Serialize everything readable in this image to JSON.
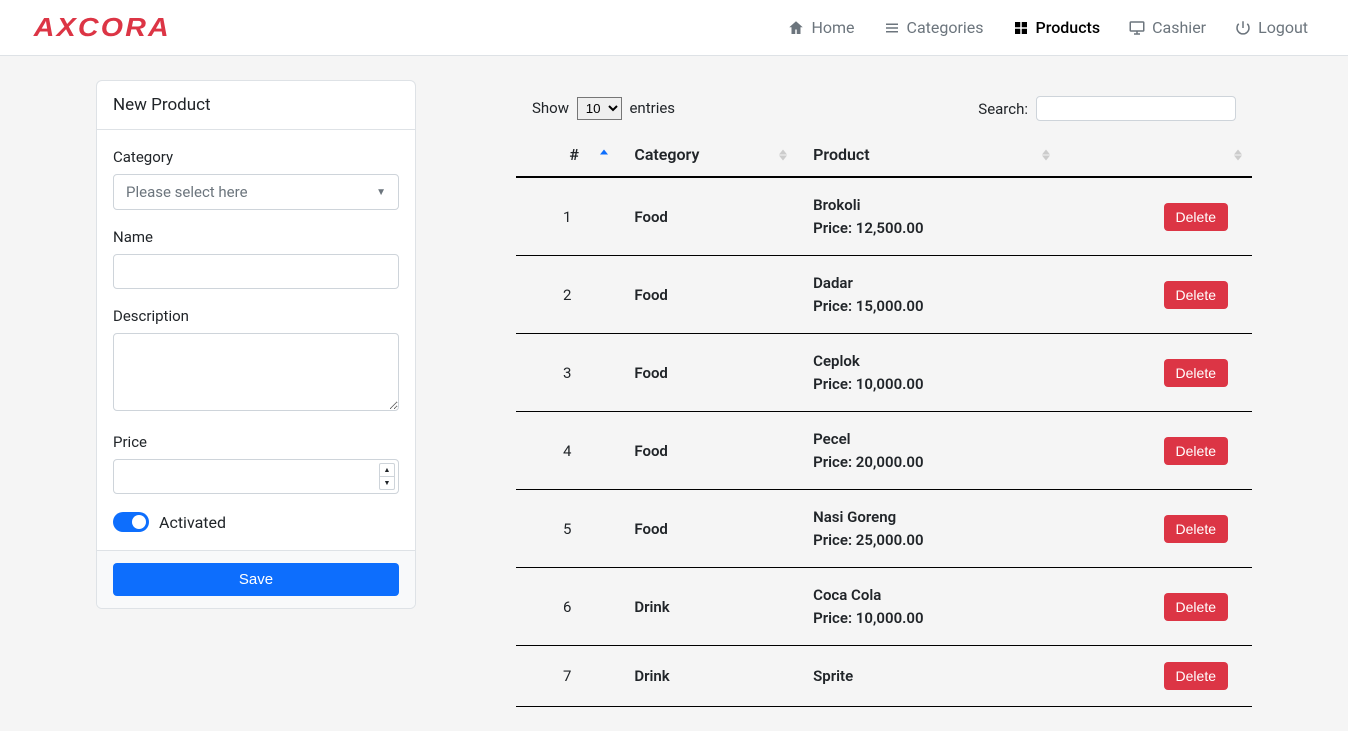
{
  "brand": "AXCORA",
  "nav": {
    "home": "Home",
    "categories": "Categories",
    "products": "Products",
    "cashier": "Cashier",
    "logout": "Logout"
  },
  "form": {
    "header": "New Product",
    "category_label": "Category",
    "category_placeholder": "Please select here",
    "name_label": "Name",
    "description_label": "Description",
    "price_label": "Price",
    "activated_label": "Activated",
    "save_label": "Save"
  },
  "table": {
    "show_label": "Show",
    "entries_label": "entries",
    "show_value": "10",
    "search_label": "Search:",
    "columns": {
      "idx": "#",
      "category": "Category",
      "product": "Product",
      "actions": ""
    },
    "delete_label": "Delete",
    "price_prefix": "Price:",
    "rows": [
      {
        "idx": "1",
        "category": "Food",
        "name": "Brokoli",
        "price": "12,500.00"
      },
      {
        "idx": "2",
        "category": "Food",
        "name": "Dadar",
        "price": "15,000.00"
      },
      {
        "idx": "3",
        "category": "Food",
        "name": "Ceplok",
        "price": "10,000.00"
      },
      {
        "idx": "4",
        "category": "Food",
        "name": "Pecel",
        "price": "20,000.00"
      },
      {
        "idx": "5",
        "category": "Food",
        "name": "Nasi Goreng",
        "price": "25,000.00"
      },
      {
        "idx": "6",
        "category": "Drink",
        "name": "Coca Cola",
        "price": "10,000.00"
      },
      {
        "idx": "7",
        "category": "Drink",
        "name": "Sprite",
        "price": ""
      }
    ]
  }
}
